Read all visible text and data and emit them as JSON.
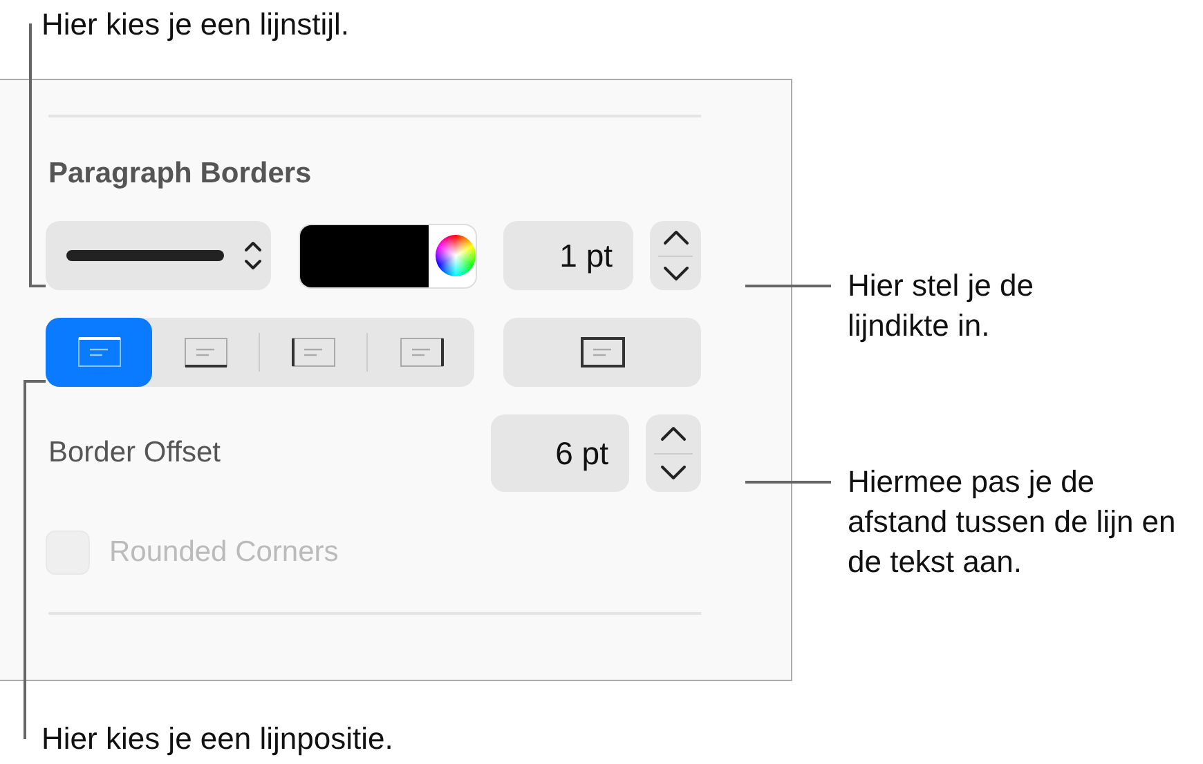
{
  "callouts": [
    {
      "text": "Hier kies je een lijnstijl."
    },
    {
      "text": "Hier stel je de lijndikte in."
    },
    {
      "text": "Hiermee pas je de afstand tussen de lijn en de tekst aan."
    },
    {
      "text": "Hier kies je een lijnpositie."
    }
  ],
  "panel": {
    "heading": "Paragraph Borders",
    "color_well": {
      "color": "#000000"
    },
    "thickness": {
      "value": "1 pt"
    },
    "positions": [
      {
        "kind": "top",
        "selected": true
      },
      {
        "kind": "bottom",
        "selected": false
      },
      {
        "kind": "left",
        "selected": false
      },
      {
        "kind": "right",
        "selected": false
      }
    ],
    "outline_button": {
      "kind": "all"
    },
    "offset": {
      "label": "Border Offset",
      "value": "6 pt"
    },
    "rounded_corners": {
      "label": "Rounded Corners",
      "checked": false,
      "disabled": true
    }
  }
}
